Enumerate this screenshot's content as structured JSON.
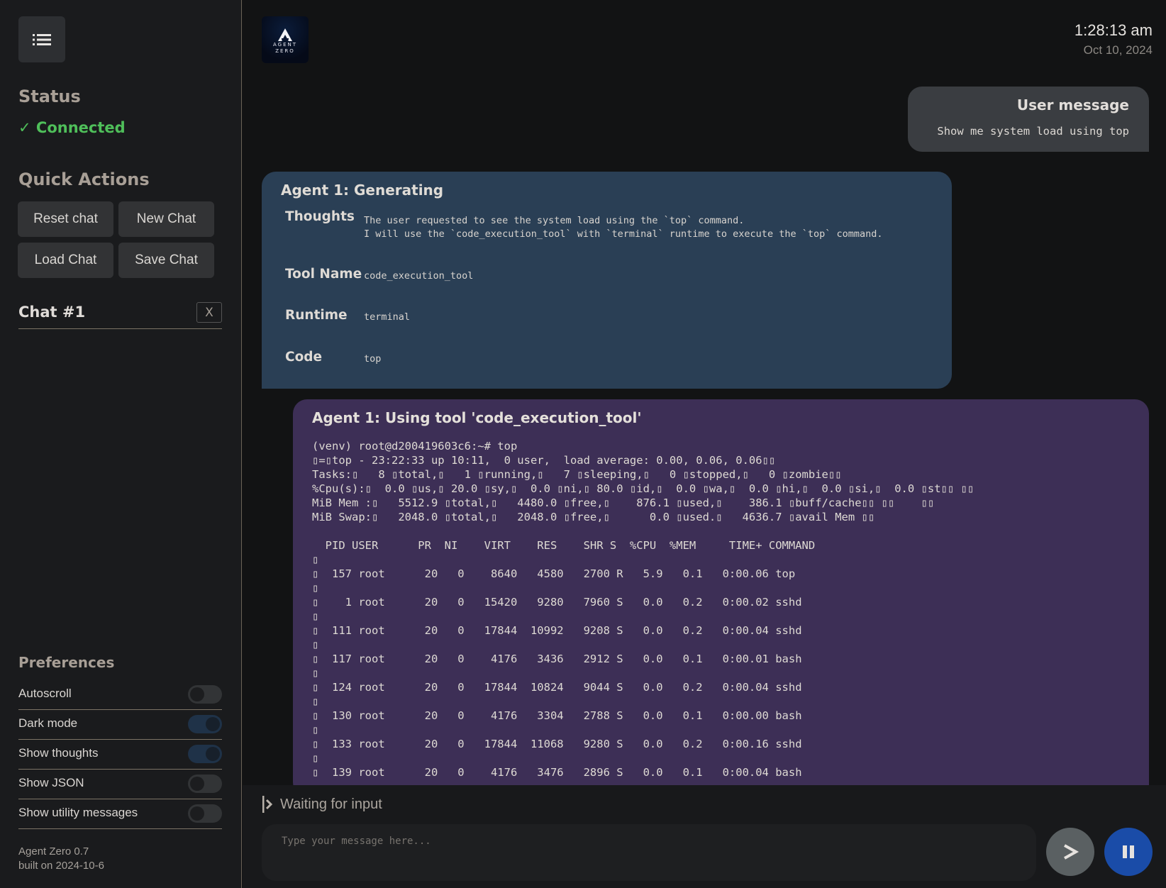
{
  "sidebar": {
    "menu_icon": "list-icon",
    "status_heading": "Status",
    "status_text": "✓ Connected",
    "status_color": "#4fbf5a",
    "quick_actions_heading": "Quick Actions",
    "quick_actions": [
      {
        "label": "Reset chat"
      },
      {
        "label": "New Chat"
      },
      {
        "label": "Load Chat"
      },
      {
        "label": "Save Chat"
      }
    ],
    "chats": [
      {
        "title": "Chat #1",
        "close_label": "X"
      }
    ],
    "preferences_heading": "Preferences",
    "preferences": [
      {
        "label": "Autoscroll",
        "enabled": false
      },
      {
        "label": "Dark mode",
        "enabled": true
      },
      {
        "label": "Show thoughts",
        "enabled": true
      },
      {
        "label": "Show JSON",
        "enabled": false
      },
      {
        "label": "Show utility messages",
        "enabled": false
      }
    ],
    "version_line1": "Agent Zero 0.7",
    "version_line2": "built on 2024-10-6"
  },
  "header": {
    "logo_text_line1": "AGENT",
    "logo_text_line2": "ZERO",
    "time": "1:28:13 am",
    "date": "Oct 10, 2024"
  },
  "messages": {
    "user": {
      "title": "User message",
      "text": "Show me system load using top"
    },
    "agent_generating": {
      "title": "Agent 1: Generating",
      "fields": [
        {
          "key": "Thoughts",
          "value": "The user requested to see the system load using the `top` command.\nI will use the `code_execution_tool` with `terminal` runtime to execute the `top` command."
        },
        {
          "key": "Tool Name",
          "value": "code_execution_tool"
        },
        {
          "key": "Runtime",
          "value": "terminal"
        },
        {
          "key": "Code",
          "value": "top"
        }
      ]
    },
    "tool_use": {
      "title": "Agent 1: Using tool 'code_execution_tool'",
      "terminal_lines": [
        "(venv) root@d200419603c6:~# top",
        "\u001b=\u001btop - 23:22:33 up 10:11,  0 user,  load average: 0.00, 0.06, 0.06\u001b\u001b",
        "Tasks:\u001b   8 \u001btotal,\u001b   1 \u001brunning,\u001b   7 \u001bsleeping,\u001b   0 \u001bstopped,\u001b   0 \u001bzombie\u001b\u001b",
        "%Cpu(s):\u001b  0.0 \u001bus,\u001b 20.0 \u001bsy,\u001b  0.0 \u001bni,\u001b 80.0 \u001bid,\u001b  0.0 \u001bwa,\u001b  0.0 \u001bhi,\u001b  0.0 \u001bsi,\u001b  0.0 \u001bst\u001b\u001b \u001b\u001b",
        "MiB Mem :\u001b   5512.9 \u001btotal,\u001b   4480.0 \u001bfree,\u001b    876.1 \u001bused,\u001b    386.1 \u001bbuff/cache\u001b\u001b \u001b\u001b    \u001b\u001b",
        "MiB Swap:\u001b   2048.0 \u001btotal,\u001b   2048.0 \u001bfree,\u001b      0.0 \u001bused.\u001b   4636.7 \u001bavail Mem \u001b\u001b",
        "",
        "  PID USER      PR  NI    VIRT    RES    SHR S  %CPU  %MEM     TIME+ COMMAND",
        "\u001b",
        "\u001b  157 root      20   0    8640   4580   2700 R   5.9   0.1   0:00.06 top",
        "\u001b",
        "\u001b    1 root      20   0   15420   9280   7960 S   0.0   0.2   0:00.02 sshd",
        "\u001b",
        "\u001b  111 root      20   0   17844  10992   9208 S   0.0   0.2   0:00.04 sshd",
        "\u001b",
        "\u001b  117 root      20   0    4176   3436   2912 S   0.0   0.1   0:00.01 bash",
        "\u001b",
        "\u001b  124 root      20   0   17844  10824   9044 S   0.0   0.2   0:00.04 sshd",
        "\u001b",
        "\u001b  130 root      20   0    4176   3304   2788 S   0.0   0.1   0:00.00 bash",
        "\u001b",
        "\u001b  133 root      20   0   17844  11068   9280 S   0.0   0.2   0:00.16 sshd",
        "\u001b",
        "\u001b  139 root      20   0    4176   3476   2896 S   0.0   0.1   0:00.04 bash"
      ],
      "processes": [
        {
          "pid": "157",
          "user": "root",
          "pr": "20",
          "ni": "0",
          "virt": "8640",
          "res": "4580",
          "shr": "2700",
          "s": "R",
          "cpu": "5.9",
          "mem": "0.1",
          "time": "0:00.06",
          "command": "top"
        },
        {
          "pid": "1",
          "user": "root",
          "pr": "20",
          "ni": "0",
          "virt": "15420",
          "res": "9280",
          "shr": "7960",
          "s": "S",
          "cpu": "0.0",
          "mem": "0.2",
          "time": "0:00.02",
          "command": "sshd"
        },
        {
          "pid": "111",
          "user": "root",
          "pr": "20",
          "ni": "0",
          "virt": "17844",
          "res": "10992",
          "shr": "9208",
          "s": "S",
          "cpu": "0.0",
          "mem": "0.2",
          "time": "0:00.04",
          "command": "sshd"
        },
        {
          "pid": "117",
          "user": "root",
          "pr": "20",
          "ni": "0",
          "virt": "4176",
          "res": "3436",
          "shr": "2912",
          "s": "S",
          "cpu": "0.0",
          "mem": "0.1",
          "time": "0:00.01",
          "command": "bash"
        },
        {
          "pid": "124",
          "user": "root",
          "pr": "20",
          "ni": "0",
          "virt": "17844",
          "res": "10824",
          "shr": "9044",
          "s": "S",
          "cpu": "0.0",
          "mem": "0.2",
          "time": "0:00.04",
          "command": "sshd"
        },
        {
          "pid": "130",
          "user": "root",
          "pr": "20",
          "ni": "0",
          "virt": "4176",
          "res": "3304",
          "shr": "2788",
          "s": "S",
          "cpu": "0.0",
          "mem": "0.1",
          "time": "0:00.00",
          "command": "bash"
        },
        {
          "pid": "133",
          "user": "root",
          "pr": "20",
          "ni": "0",
          "virt": "17844",
          "res": "11068",
          "shr": "9280",
          "s": "S",
          "cpu": "0.0",
          "mem": "0.2",
          "time": "0:00.16",
          "command": "sshd"
        },
        {
          "pid": "139",
          "user": "root",
          "pr": "20",
          "ni": "0",
          "virt": "4176",
          "res": "3476",
          "shr": "2896",
          "s": "S",
          "cpu": "0.0",
          "mem": "0.1",
          "time": "0:00.04",
          "command": "bash"
        }
      ]
    }
  },
  "input": {
    "progress_text": "Waiting for input",
    "placeholder": "Type your message here...",
    "value": "",
    "send_icon": "send-icon",
    "pause_icon": "pause-icon"
  },
  "colors": {
    "sidebar_bg": "#1a1b1d",
    "main_bg": "#121314",
    "user_bubble": "#3a3d41",
    "agent_bubble": "#2a3f55",
    "tool_bubble": "#3d2f56",
    "pause_button": "#1a4ca8",
    "send_button": "#5a6062"
  }
}
